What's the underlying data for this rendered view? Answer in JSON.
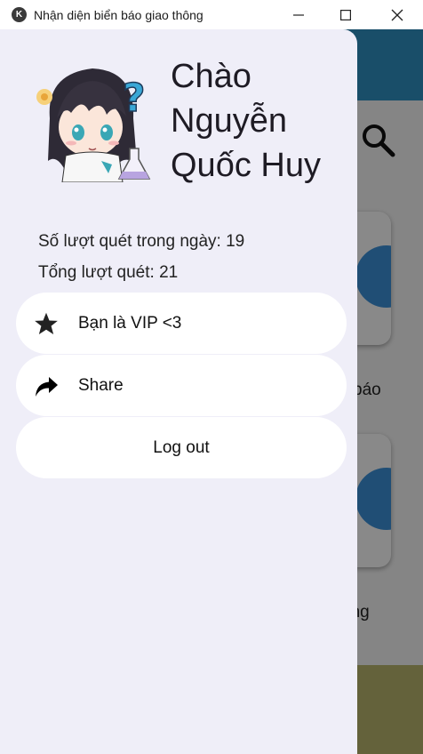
{
  "window": {
    "title": "Nhận diện biển báo giao thông",
    "app_icon": "app-logo-icon"
  },
  "background": {
    "appbar_color": "#2f8fbf",
    "labels": [
      "báo",
      "ùng"
    ]
  },
  "drawer": {
    "greeting_lines": [
      "Chào",
      "Nguyễn",
      "Quốc Huy"
    ],
    "stats": {
      "daily_scans": "Số lượt quét trong ngày: 19",
      "total_scans": "Tổng lượt quét: 21"
    },
    "menu": [
      {
        "label": "Bạn là VIP <3",
        "icon": "star-icon"
      },
      {
        "label": "Share",
        "icon": "share-arrow-icon"
      },
      {
        "label": "Log out"
      }
    ]
  }
}
